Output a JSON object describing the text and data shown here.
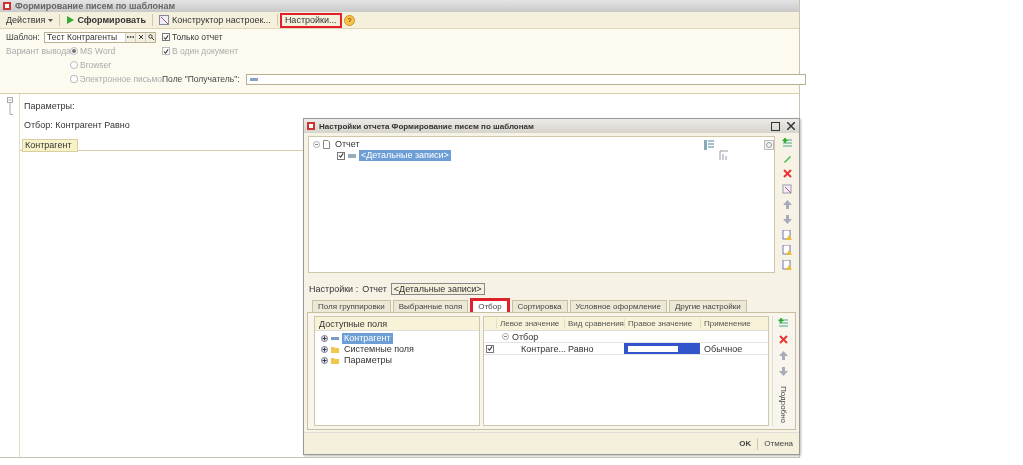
{
  "window": {
    "title": "Формирование писем по шаблонам"
  },
  "toolbar": [
    {
      "kind": "menu",
      "label": "Действия",
      "highlighted": false
    },
    {
      "kind": "run",
      "label": "Сформировать",
      "highlighted": false
    },
    {
      "kind": "constructor",
      "label": "Конструктор настроек...",
      "highlighted": false
    },
    {
      "kind": "plain",
      "label": "Настройки...",
      "highlighted": true
    },
    {
      "kind": "help",
      "highlighted": false
    }
  ],
  "form": {
    "template_label": "Шаблон:",
    "template_value": "Тест Контрагенты",
    "only_report": {
      "label": "Только отчет",
      "checked": true,
      "disabled": false
    },
    "output_label": "Вариант вывода:",
    "output_options": [
      {
        "label": "MS Word",
        "selected": true,
        "disabled": true
      },
      {
        "label": "Browser",
        "selected": false,
        "disabled": true
      },
      {
        "label": "Электронное письмо",
        "selected": false,
        "disabled": true
      }
    ],
    "one_document": {
      "label": "В один документ",
      "checked": true,
      "disabled": true
    },
    "recipient_label": "Поле \"Получатель\":"
  },
  "report": {
    "lines": [
      "Параметры:",
      "Отбор: Контрагент Равно"
    ],
    "header_cell": "Контрагент"
  },
  "dialog": {
    "title": "Настройки отчета  Формирование писем по шаблонам",
    "tree": [
      {
        "label": "Отчет",
        "expanded": true,
        "children": [
          {
            "label": "<Детальные записи>",
            "checked": true,
            "selected": true
          }
        ]
      }
    ],
    "settings_label": "Настройки :",
    "settings_path": [
      "Отчет",
      "<Детальные записи>"
    ],
    "tabs": [
      {
        "label": "Поля группировки",
        "selected": false,
        "highlighted": false
      },
      {
        "label": "Выбранные поля",
        "selected": false,
        "highlighted": false
      },
      {
        "label": "Отбор",
        "selected": true,
        "highlighted": true
      },
      {
        "label": "Сортировка",
        "selected": false,
        "highlighted": false
      },
      {
        "label": "Условное оформление",
        "selected": false,
        "highlighted": false
      },
      {
        "label": "Другие настройки",
        "selected": false,
        "highlighted": false
      }
    ],
    "available": {
      "header": "Доступные поля",
      "items": [
        {
          "kind": "field",
          "label": "Контрагент",
          "selected": true
        },
        {
          "kind": "folder",
          "label": "Системные поля",
          "selected": false
        },
        {
          "kind": "folder",
          "label": "Параметры",
          "selected": false
        }
      ]
    },
    "filter": {
      "columns": [
        "Левое значение",
        "Вид сравнения",
        "Правое значение",
        "Применение"
      ],
      "group": {
        "label": "Отбор",
        "expanded": true
      },
      "rows": [
        {
          "checked": true,
          "left": "Контраге...",
          "comparison": "Равно",
          "right_redacted": true,
          "usage": "Обычное"
        }
      ]
    },
    "side_label": "Подробно",
    "buttons": [
      {
        "label": "OK",
        "primary": true
      },
      {
        "label": "Отмена",
        "primary": false
      }
    ]
  }
}
